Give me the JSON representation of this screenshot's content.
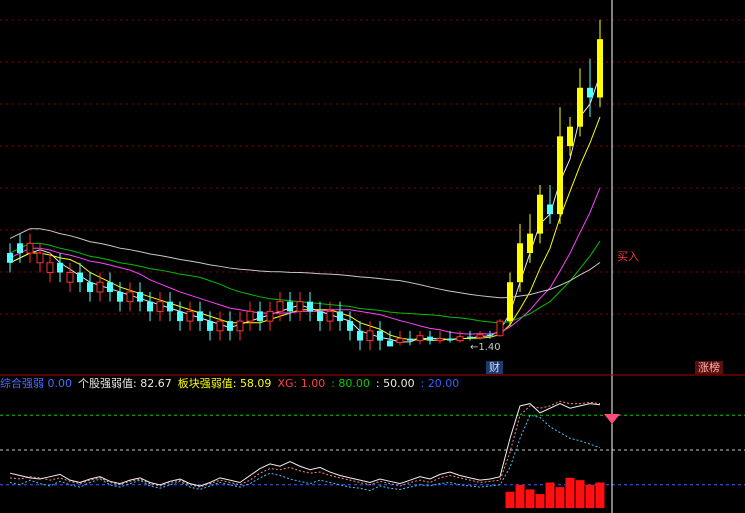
{
  "chart_data": {
    "type": "candlestick",
    "main_panel": {
      "low_annotation": "←1.40",
      "signal_label": "买入",
      "event_badges": [
        "财",
        "涨榜"
      ]
    },
    "indicator_bar": {
      "items": [
        {
          "label": "综合强弱",
          "value": "0.00",
          "color": "#4a6cff"
        },
        {
          "label": "个股强弱值:",
          "value": "82.67",
          "color": "#e8e8e8"
        },
        {
          "label": "板块强弱值:",
          "value": "58.09",
          "color": "#ffff00"
        },
        {
          "label": "XG:",
          "value": "1.00",
          "color": "#ff4040"
        },
        {
          "label": "",
          "value": ": 80.00",
          "color": "#00d000"
        },
        {
          "label": "",
          "value": ": 50.00",
          "color": "#e8e8e8"
        },
        {
          "label": "",
          "value": ": 20.00",
          "color": "#3a5cff"
        }
      ]
    },
    "colors": {
      "up": "#ff3030",
      "down": "#54ffff",
      "signal_up": "#ffff00",
      "ma_white": "#e8e8e8",
      "ma_yellow": "#ffff00",
      "ma_magenta": "#ff40ff",
      "ma_green": "#00c000",
      "ma_grey": "#c8c8c8"
    },
    "candles": [
      [
        11,
        10,
        12,
        9
      ],
      [
        12,
        11,
        13,
        10
      ],
      [
        11,
        12,
        13,
        10
      ],
      [
        10,
        11,
        12,
        9
      ],
      [
        9,
        10,
        11,
        8
      ],
      [
        10,
        9,
        11,
        8
      ],
      [
        8,
        9,
        10,
        7
      ],
      [
        9,
        8,
        10,
        7
      ],
      [
        8,
        7,
        9,
        6
      ],
      [
        7,
        8,
        9,
        6
      ],
      [
        8,
        7,
        9,
        6
      ],
      [
        7,
        6,
        8,
        5
      ],
      [
        6,
        7,
        8,
        5
      ],
      [
        7,
        6,
        8,
        5
      ],
      [
        6,
        5,
        7,
        4
      ],
      [
        5,
        6,
        7,
        4
      ],
      [
        6,
        5,
        7,
        4
      ],
      [
        5,
        4,
        6,
        3
      ],
      [
        4,
        5,
        6,
        3
      ],
      [
        5,
        4,
        6,
        3
      ],
      [
        4,
        3,
        5,
        2
      ],
      [
        3,
        4,
        5,
        2
      ],
      [
        4,
        3,
        5,
        2
      ],
      [
        3,
        4,
        5,
        2
      ],
      [
        4,
        5,
        6,
        3
      ],
      [
        5,
        4,
        6,
        3
      ],
      [
        4,
        5,
        6,
        3
      ],
      [
        5,
        6,
        7,
        4
      ],
      [
        6,
        5,
        7,
        4
      ],
      [
        5,
        6,
        7,
        4
      ],
      [
        6,
        5,
        7,
        4
      ],
      [
        5,
        4,
        6,
        3
      ],
      [
        4,
        5,
        6,
        3
      ],
      [
        5,
        4,
        6,
        3
      ],
      [
        4,
        3,
        5,
        2
      ],
      [
        3,
        2,
        4,
        1
      ],
      [
        2,
        3,
        4,
        1
      ],
      [
        3,
        2,
        4,
        1
      ],
      [
        2,
        1.4,
        3,
        1.4
      ],
      [
        1.8,
        2.2,
        3,
        1.5
      ],
      [
        2.2,
        2,
        3,
        1.5
      ],
      [
        2,
        2.5,
        3,
        1.6
      ],
      [
        2.4,
        2,
        3,
        1.6
      ],
      [
        2,
        2.2,
        3,
        1.7
      ],
      [
        2.2,
        2,
        3,
        1.8
      ],
      [
        2,
        2.4,
        3,
        1.8
      ],
      [
        2.4,
        2.3,
        3,
        2
      ],
      [
        2.3,
        2.6,
        3,
        2.1
      ],
      [
        2.6,
        2.5,
        3,
        2.2
      ],
      [
        2.5,
        4,
        4.2,
        2.4
      ],
      [
        4,
        8,
        9,
        3.5
      ],
      [
        8,
        12,
        14,
        7
      ],
      [
        11,
        13,
        15,
        10
      ],
      [
        13,
        17,
        18,
        12
      ],
      [
        16,
        15,
        18,
        14
      ],
      [
        15,
        23,
        26,
        14
      ],
      [
        22,
        24,
        25,
        21
      ],
      [
        24,
        28,
        30,
        23
      ],
      [
        28,
        27,
        31,
        25
      ],
      [
        27,
        33,
        35,
        26
      ]
    ],
    "ylim": [
      0,
      36
    ],
    "indicator_levels": [
      80,
      50,
      20
    ],
    "indicator_white": [
      30,
      28,
      26,
      25,
      27,
      29,
      24,
      22,
      25,
      27,
      23,
      21,
      24,
      26,
      22,
      20,
      23,
      25,
      21,
      19,
      22,
      26,
      24,
      22,
      28,
      34,
      38,
      36,
      40,
      36,
      33,
      35,
      31,
      28,
      26,
      24,
      22,
      25,
      23,
      21,
      24,
      27,
      25,
      29,
      31,
      28,
      26,
      24,
      25,
      27,
      60,
      88,
      90,
      82,
      86,
      90,
      86,
      88,
      90,
      89
    ],
    "indicator_cyan": [
      22,
      20,
      24,
      21,
      19,
      23,
      20,
      18,
      22,
      25,
      20,
      18,
      21,
      24,
      19,
      17,
      20,
      23,
      18,
      16,
      19,
      22,
      20,
      18,
      21,
      26,
      30,
      28,
      25,
      23,
      21,
      24,
      22,
      20,
      18,
      17,
      15,
      19,
      17,
      16,
      18,
      20,
      19,
      21,
      22,
      20,
      19,
      18,
      19,
      20,
      35,
      60,
      80,
      78,
      70,
      65,
      60,
      58,
      55,
      52
    ],
    "indicator_pink": [
      26,
      25,
      27,
      26,
      24,
      26,
      23,
      21,
      24,
      26,
      22,
      20,
      23,
      25,
      21,
      19,
      22,
      24,
      20,
      18,
      21,
      24,
      22,
      20,
      24,
      30,
      34,
      33,
      35,
      32,
      30,
      31,
      28,
      26,
      24,
      22,
      20,
      23,
      21,
      19,
      22,
      24,
      22,
      26,
      28,
      26,
      24,
      22,
      23,
      24,
      48,
      80,
      88,
      86,
      88,
      92,
      90,
      90,
      91,
      90
    ],
    "indicator_bars": [
      0,
      0,
      0,
      0,
      0,
      0,
      0,
      0,
      0,
      0,
      0,
      0,
      0,
      0,
      0,
      0,
      0,
      0,
      0,
      0,
      0,
      0,
      0,
      0,
      0,
      0,
      0,
      0,
      0,
      0,
      0,
      0,
      0,
      0,
      0,
      0,
      0,
      0,
      0,
      0,
      0,
      0,
      0,
      0,
      0,
      0,
      0,
      0,
      0,
      0,
      14,
      20,
      16,
      12,
      22,
      18,
      26,
      24,
      20,
      22
    ]
  }
}
